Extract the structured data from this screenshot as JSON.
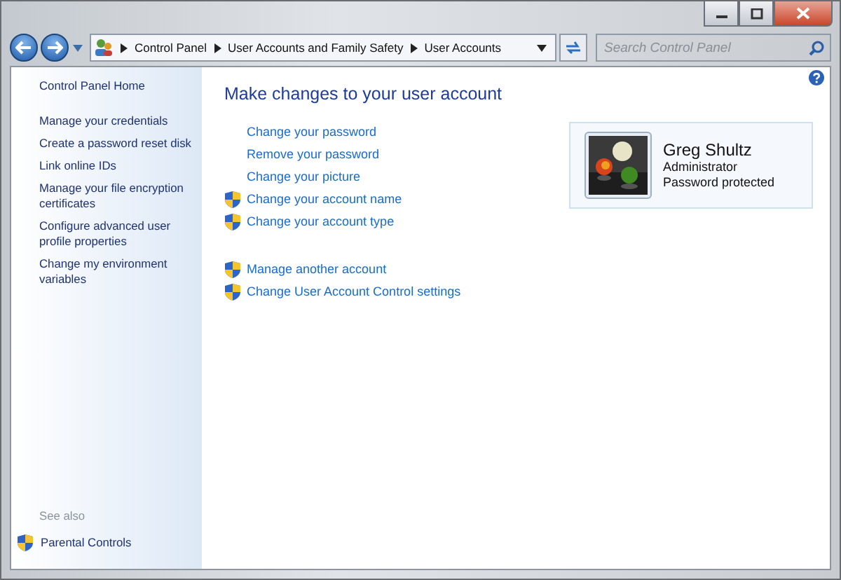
{
  "address_bar": {
    "crumbs": [
      "Control Panel",
      "User Accounts and Family Safety",
      "User Accounts"
    ]
  },
  "search": {
    "placeholder": "Search Control Panel"
  },
  "sidebar": {
    "home": "Control Panel Home",
    "items": [
      "Manage your credentials",
      "Create a password reset disk",
      "Link online IDs",
      "Manage your file encryption certificates",
      "Configure advanced user profile properties",
      "Change my environment variables"
    ],
    "see_also": {
      "heading": "See also",
      "items": [
        {
          "label": "Parental Controls",
          "kind": "shield"
        }
      ]
    }
  },
  "main": {
    "title": "Make changes to your user account",
    "task_groups": [
      [
        {
          "label": "Change your password",
          "kind": "plain"
        },
        {
          "label": "Remove your password",
          "kind": "plain"
        },
        {
          "label": "Change your picture",
          "kind": "plain"
        },
        {
          "label": "Change your account name",
          "kind": "shield"
        },
        {
          "label": "Change your account type",
          "kind": "shield"
        }
      ],
      [
        {
          "label": "Manage another account",
          "kind": "shield"
        },
        {
          "label": "Change User Account Control settings",
          "kind": "shield"
        }
      ]
    ]
  },
  "account": {
    "name": "Greg Shultz",
    "type": "Administrator",
    "status": "Password protected"
  }
}
